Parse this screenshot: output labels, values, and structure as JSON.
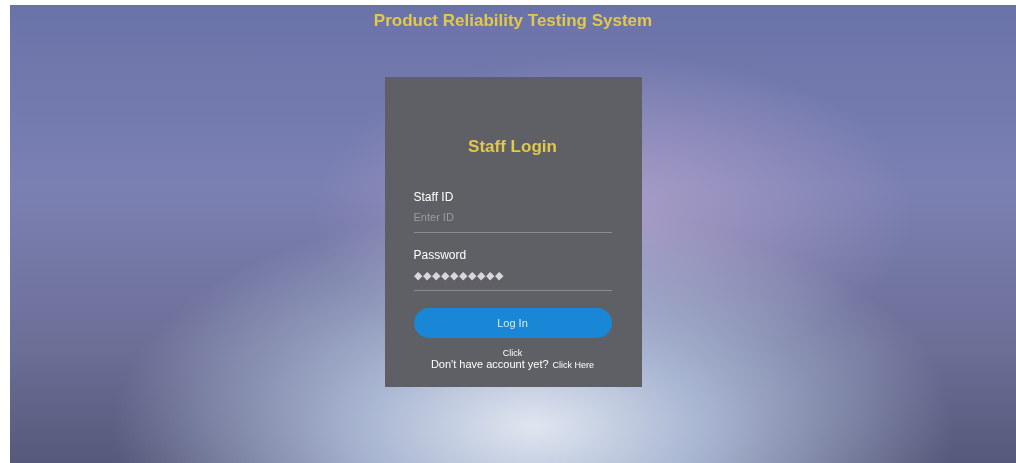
{
  "header": {
    "title": "Product Reliability Testing System"
  },
  "login": {
    "title": "Staff Login",
    "fields": [
      {
        "label": "Staff ID",
        "placeholder": "Enter ID",
        "kind": "text"
      },
      {
        "label": "Password",
        "value": "◆◆◆◆◆◆◆◆◆◆",
        "kind": "password"
      }
    ],
    "button": "Log In",
    "click_note": "Click",
    "signup_text": "Don't have account yet?",
    "signup_link": "Click Here"
  }
}
